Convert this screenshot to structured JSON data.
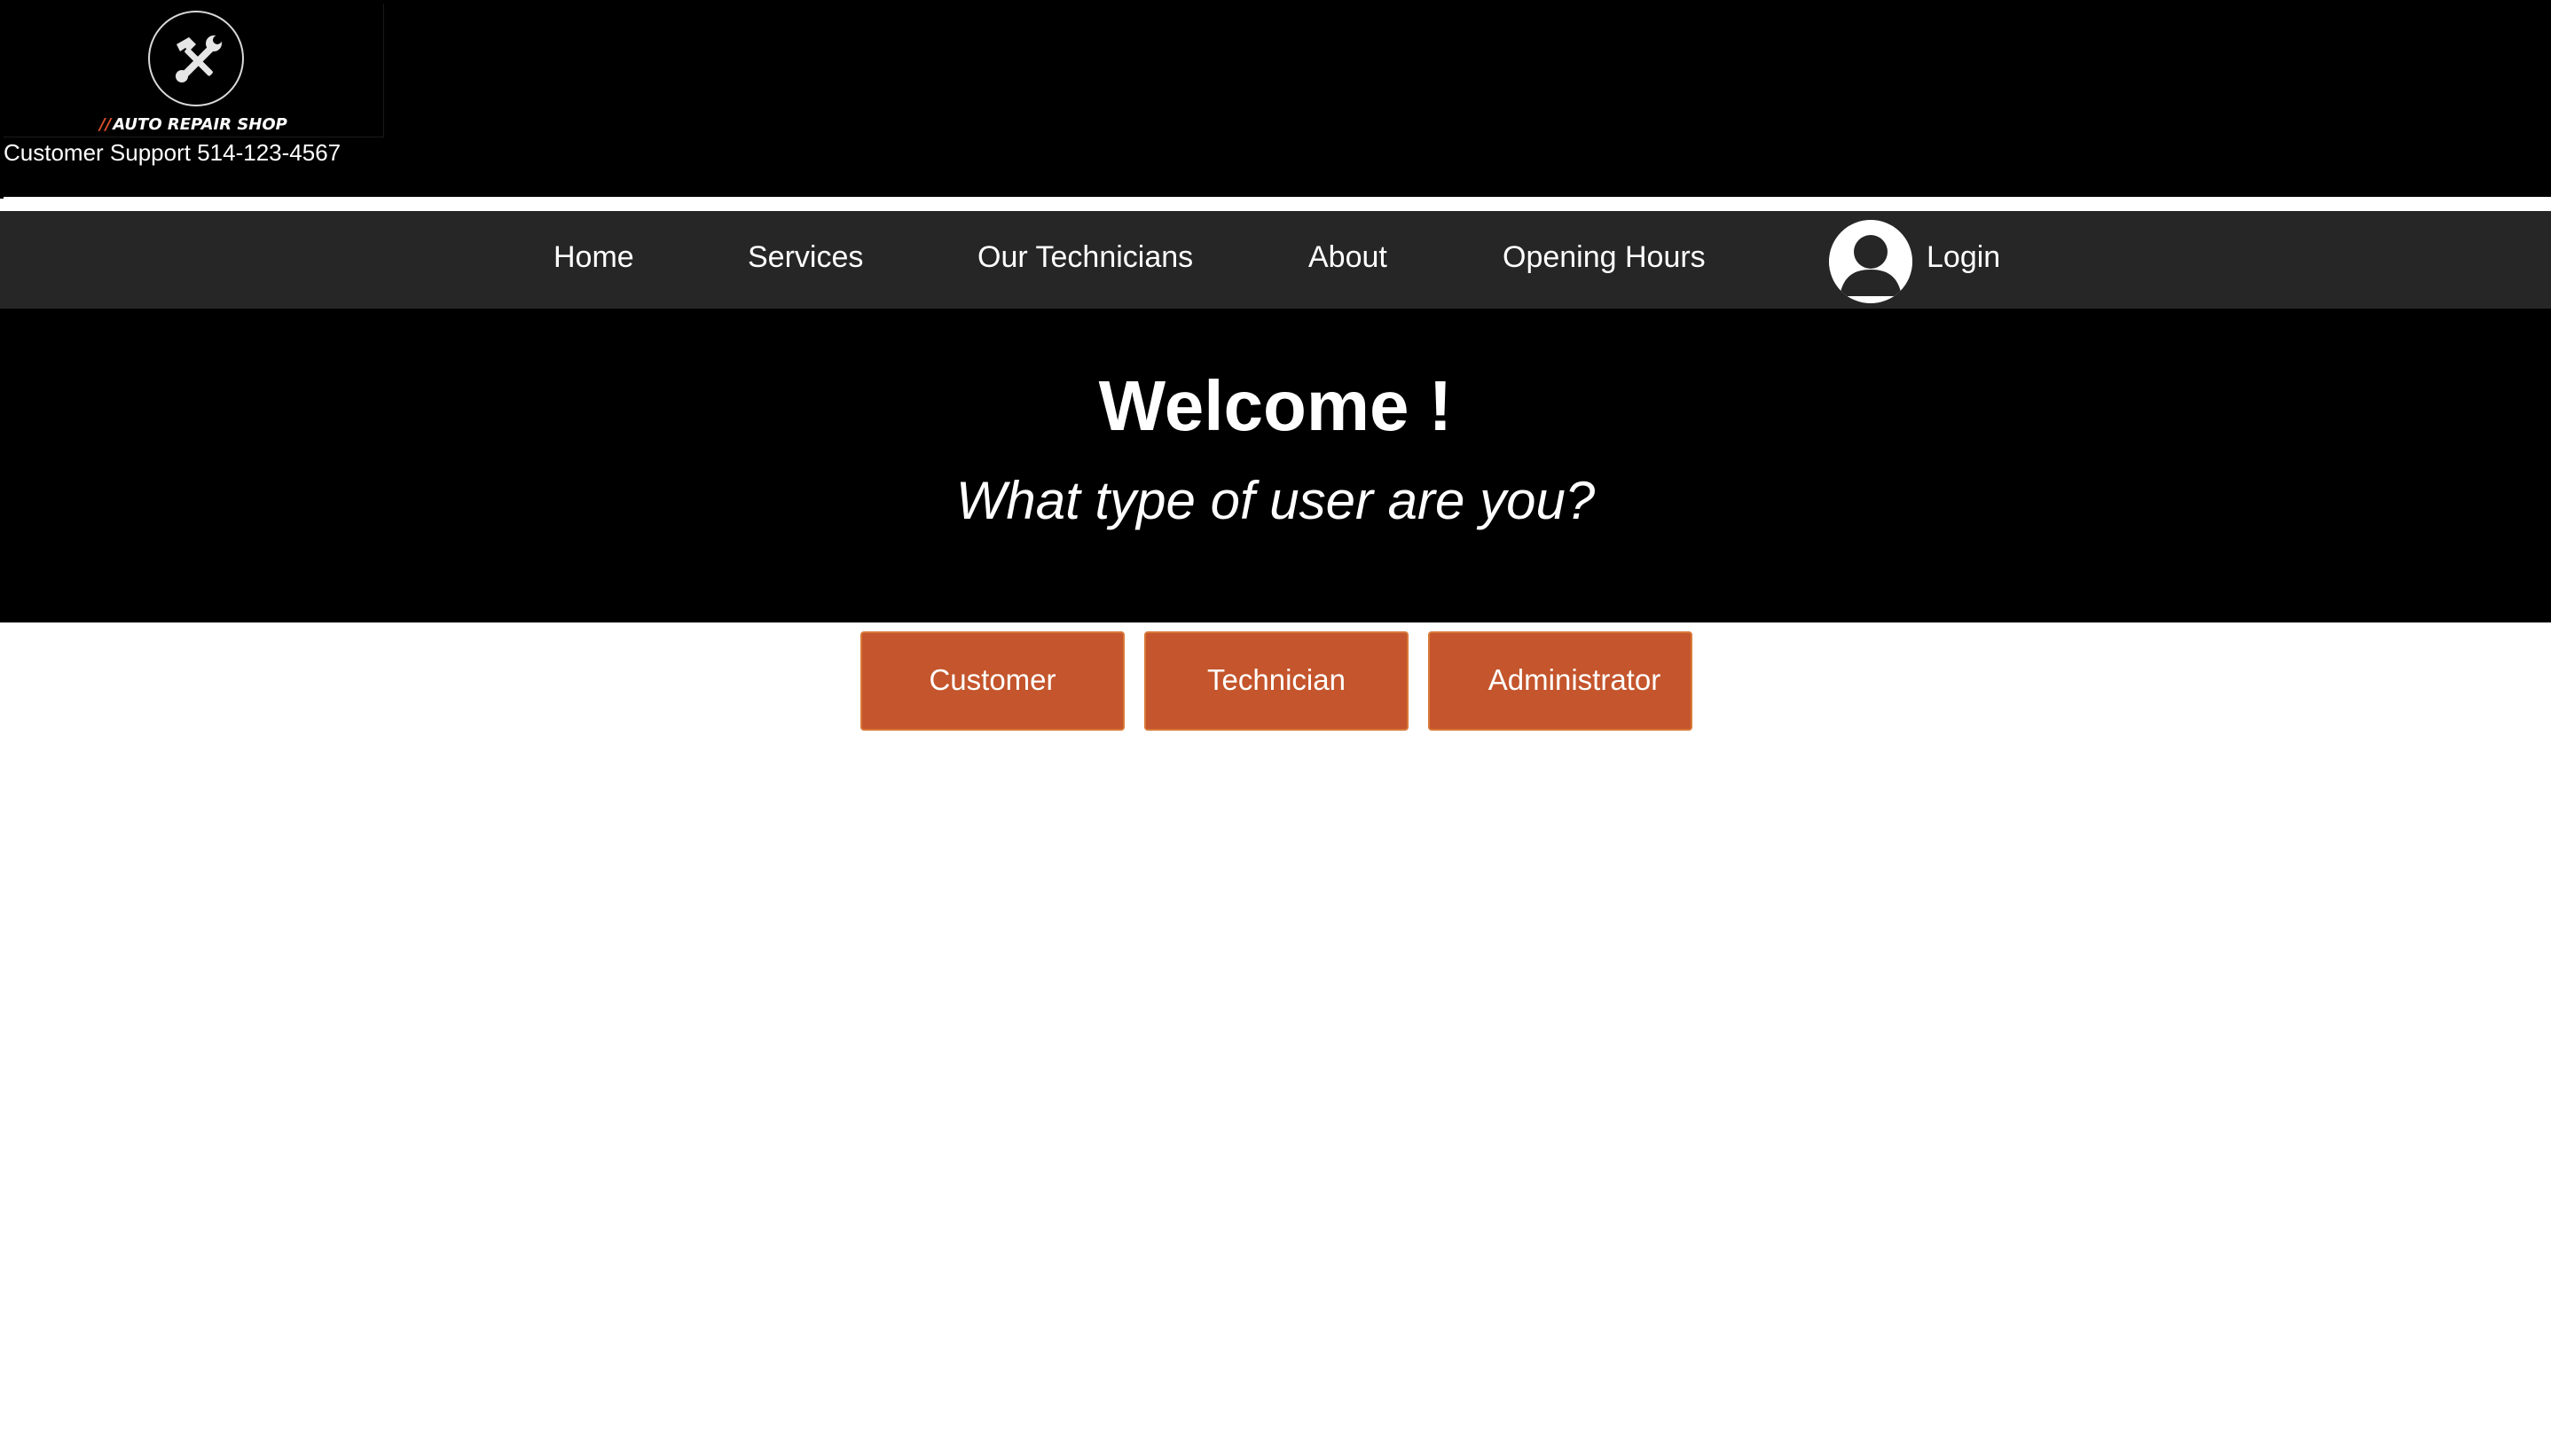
{
  "header": {
    "logo_icon": "hammer-wrench-icon",
    "logo_text_slashes": "//",
    "logo_text": "AUTO REPAIR SHOP",
    "support": "Customer Support 514-123-4567"
  },
  "nav": {
    "items": [
      {
        "label": "Home"
      },
      {
        "label": "Services"
      },
      {
        "label": "Our Technicians"
      },
      {
        "label": "About"
      },
      {
        "label": "Opening Hours"
      }
    ],
    "login_icon": "user-avatar-icon",
    "login_label": "Login"
  },
  "hero": {
    "title": "Welcome !",
    "subtitle": "What type of user are you?"
  },
  "roles": {
    "customer": "Customer",
    "technician": "Technician",
    "administrator": "Administrator"
  },
  "colors": {
    "header_bg": "#000000",
    "nav_bg": "#262626",
    "button_bg": "#c4552c",
    "button_border": "#d9793a",
    "logo_accent": "#e0502a"
  }
}
